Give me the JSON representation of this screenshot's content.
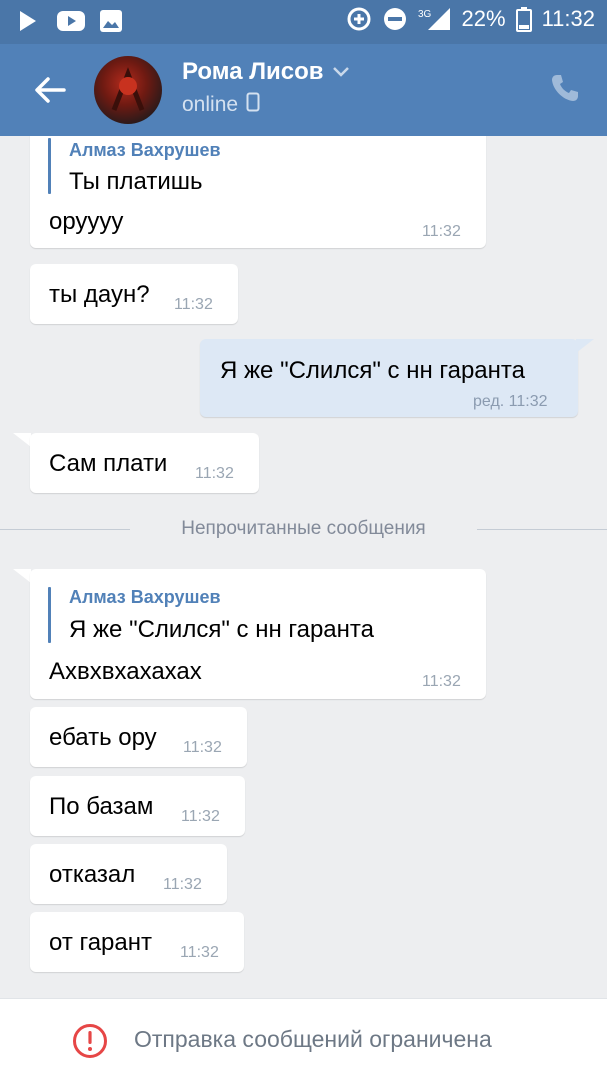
{
  "status_bar": {
    "network": "3G",
    "battery": "22%",
    "time": "11:32",
    "left_icons": [
      "play-icon",
      "youtube-icon",
      "gallery-icon"
    ],
    "right_icons": [
      "data-saver-icon",
      "dnd-icon",
      "signal-icon",
      "battery-icon"
    ]
  },
  "header": {
    "contact_name": "Рома Лисов",
    "status": "online",
    "icons": [
      "back-arrow-icon",
      "chevron-down-icon",
      "mobile-icon",
      "phone-icon"
    ]
  },
  "messages": [
    {
      "direction": "in",
      "forward_author": "Алмаз Вахрушев",
      "forward_text": "Ты платишь",
      "text": "оруууу",
      "time": "11:32"
    },
    {
      "direction": "in",
      "text": "ты даун?",
      "time": "11:32"
    },
    {
      "direction": "out",
      "text": "Я же \"Слился\" с нн гаранта",
      "time": "ред. 11:32"
    },
    {
      "direction": "in",
      "text": "Сам плати",
      "time": "11:32"
    },
    {
      "direction": "in",
      "forward_author": "Алмаз Вахрушев",
      "forward_text": "Я же \"Слился\" с нн гаранта",
      "text": "Ахвхвхахахах",
      "time": "11:32"
    },
    {
      "direction": "in",
      "text": "ебать ору",
      "time": "11:32"
    },
    {
      "direction": "in",
      "text": "По базам",
      "time": "11:32"
    },
    {
      "direction": "in",
      "text": "отказал",
      "time": "11:32"
    },
    {
      "direction": "in",
      "text": "от гарант",
      "time": "11:32"
    }
  ],
  "unread_divider": "Непрочитанные сообщения",
  "footer": {
    "restriction_text": "Отправка сообщений ограничена"
  },
  "colors": {
    "header": "#5181b8",
    "status_bar": "#4a76a8",
    "outgoing_bubble": "#dde8f5",
    "background": "#edeef0",
    "accent": "#5181b8",
    "alert": "#e64646"
  }
}
